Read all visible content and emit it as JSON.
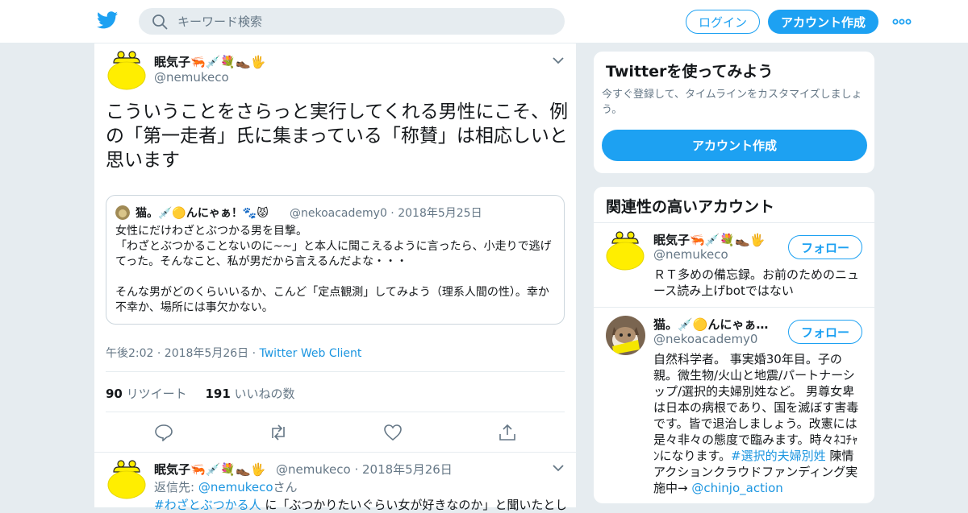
{
  "header": {
    "search_placeholder": "キーワード検索",
    "login_label": "ログイン",
    "signup_label": "アカウント作成"
  },
  "tweet": {
    "name": "眠気子🦐💉💐👞🖐",
    "handle": "@nemukeco",
    "text": "こういうことをさらっと実行してくれる男性にこそ、例の「第一走者」氏に集まっている「称賛」は相応しいと思います",
    "quote": {
      "name": "猫。💉🟡んにゃぁ！🐾😾",
      "handle": "@nekoacademy0",
      "date": "2018年5月25日",
      "text": "女性にだけわざとぶつかる男を目撃。\n「わざとぶつかることないのに~~」と本人に聞こえるように言ったら、小走りで逃げてった。そんなこと、私が男だから言えるんだよな・・・\n\nそんな男がどのくらいいるか、こんど「定点観測」してみよう（理系人間の性）。幸か不幸か、場所には事欠かない。"
    },
    "timestamp": "午後2:02 · 2018年5月26日",
    "source": "Twitter Web Client",
    "retweets": "90",
    "retweets_label": "リツイート",
    "likes": "191",
    "likes_label": "いいねの数"
  },
  "reply": {
    "name": "眠気子🦐💉💐👞🖐",
    "handle": "@nemukeco",
    "date": "2018年5月26日",
    "reply_prefix": "返信先:",
    "reply_to": "@nemukeco",
    "reply_suffix": "さん",
    "hashtag": "#わざとぶつかる人",
    "text_rest": "に「ぶつかりたいぐらい女が好きなのか」と聞いたとし"
  },
  "sidebar": {
    "try_title": "Twitterを使ってみよう",
    "try_sub": "今すぐ登録して、タイムラインをカスタマイズしましょう。",
    "try_button": "アカウント作成",
    "related_title": "関連性の高いアカウント",
    "follow_label": "フォロー",
    "accounts": [
      {
        "name": "眠気子🦐💉💐👞🖐",
        "handle": "@nemukeco",
        "bio": "ＲＴ多めの備忘録。お前のためのニュース読み上げbotではない"
      },
      {
        "name": "猫。💉🟡んにゃぁ…",
        "handle": "@nekoacademy0",
        "bio": "自然科学者。 事実婚30年目。子の親。微生物/火山と地震/パートナーシップ/選択的夫婦別姓など。 男尊女卑は日本の病根であり、国を滅ぼす害毒です。皆で退治しましょう。改憲には是々非々の態度で臨みます。時々ﾈｺﾁｬﾝになります。",
        "bio_hashtag": "#選択的夫婦別姓",
        "bio_tail": "陳情アクションクラウドファンディング実施中→",
        "bio_link": "@chinjo_action"
      }
    ]
  },
  "colors": {
    "accent": "#1da1f2",
    "link": "#1b95e0",
    "muted": "#657786",
    "background": "#e6ecf0"
  }
}
